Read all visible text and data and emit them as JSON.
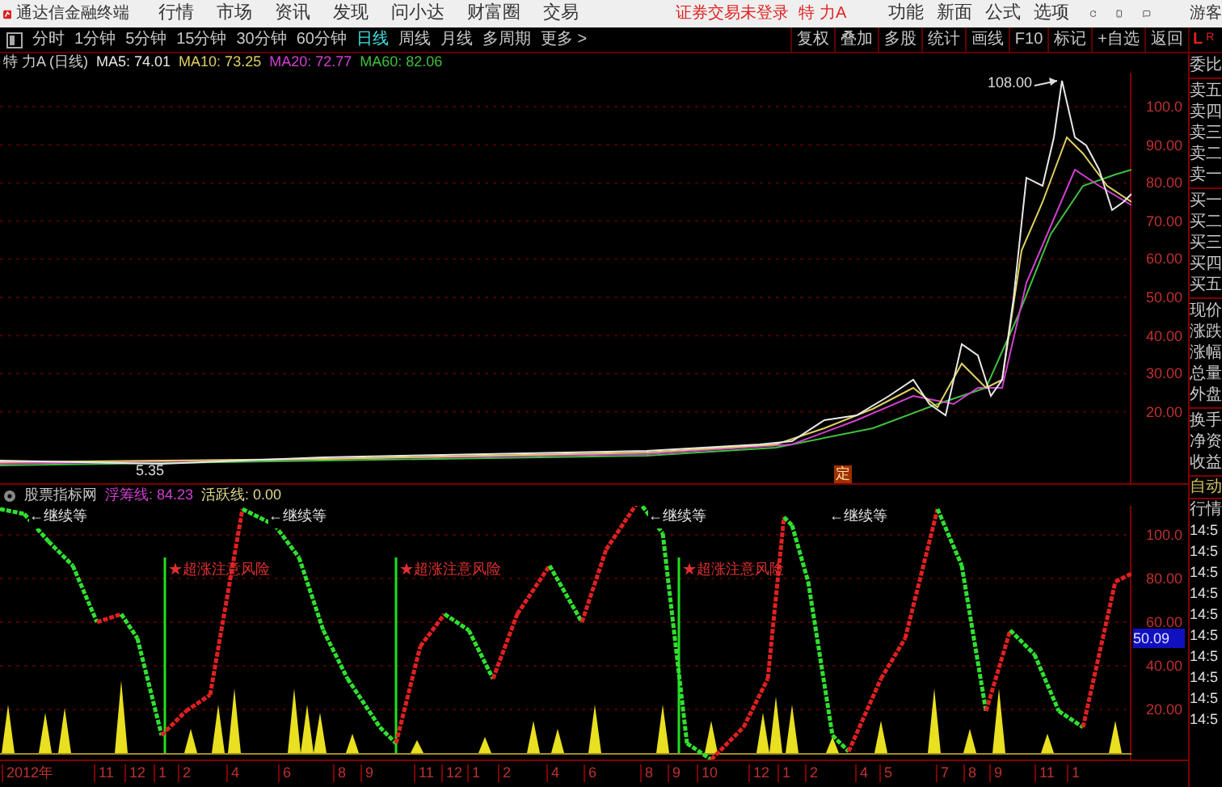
{
  "app_title": "通达信金融终端",
  "menu": [
    "行情",
    "市场",
    "资讯",
    "发现",
    "问小达",
    "财富圈",
    "交易"
  ],
  "login_status": "证券交易未登录",
  "stock_name": "特 力A",
  "menu_right": [
    "功能",
    "新面",
    "公式",
    "选项"
  ],
  "user": "游客",
  "periods": [
    {
      "label": "分时",
      "selected": false
    },
    {
      "label": "1分钟",
      "selected": false
    },
    {
      "label": "5分钟",
      "selected": false
    },
    {
      "label": "15分钟",
      "selected": false
    },
    {
      "label": "30分钟",
      "selected": false
    },
    {
      "label": "60分钟",
      "selected": false
    },
    {
      "label": "日线",
      "selected": true
    },
    {
      "label": "周线",
      "selected": false
    },
    {
      "label": "月线",
      "selected": false
    },
    {
      "label": "多周期",
      "selected": false
    }
  ],
  "more": "更多 >",
  "tools": [
    "复权",
    "叠加",
    "多股",
    "统计",
    "画线",
    "F10",
    "标记",
    "+自选",
    "返回"
  ],
  "price_chart": {
    "title": "特 力A (日线)",
    "ma": [
      {
        "label": "MA5: 74.01",
        "color": "#e8e8e8"
      },
      {
        "label": "MA10: 73.25",
        "color": "#e0d060"
      },
      {
        "label": "MA20: 72.77",
        "color": "#d040d0"
      },
      {
        "label": "MA60: 82.06",
        "color": "#40c040"
      }
    ],
    "axis_labels": [
      "100.0",
      "90.00",
      "80.00",
      "70.00",
      "60.00",
      "50.00",
      "40.00",
      "30.00",
      "20.00"
    ],
    "high_label": "108.00",
    "low_label": "5.35",
    "marker": "定"
  },
  "indicator": {
    "name": "股票指标网",
    "lines": [
      {
        "label": "浮筹线: 84.23",
        "color": "#d040d0"
      },
      {
        "label": "活跃线: 0.00",
        "color": "#e0d890"
      }
    ],
    "axis_labels": [
      "100.0",
      "80.00",
      "60.00",
      "40.00",
      "20.00"
    ],
    "current_value": "50.09",
    "wait_labels": [
      "←继续等",
      "←继续等",
      "←继续等",
      "←继续等"
    ],
    "risk_labels": [
      "★超涨注意风险",
      "★超涨注意风险",
      "★超涨注意风险"
    ]
  },
  "date_axis": [
    "2012年",
    "11",
    "12",
    "1",
    "2",
    "4",
    "6",
    "8",
    "9",
    "11",
    "12",
    "1",
    "2",
    "4",
    "6",
    "8",
    "9",
    "10",
    "12",
    "1",
    "2",
    "4",
    "5",
    "7",
    "8",
    "9",
    "11",
    "1"
  ],
  "side_panel": {
    "corner": [
      "L",
      "R"
    ],
    "quote_groups": [
      [
        "委比"
      ],
      [
        "卖五",
        "卖四",
        "卖三",
        "卖二",
        "卖一"
      ],
      [
        "买一",
        "买二",
        "买三",
        "买四",
        "买五"
      ],
      [
        "现价",
        "涨跌",
        "涨幅",
        "总量",
        "外盘"
      ],
      [
        "换手",
        "净资",
        "收益"
      ]
    ],
    "mode": "自动",
    "section": "行情",
    "times": [
      "14:5",
      "14:5",
      "14:5",
      "14:5",
      "14:5",
      "14:5",
      "14:5",
      "14:5",
      "14:5",
      "14:5"
    ]
  }
}
